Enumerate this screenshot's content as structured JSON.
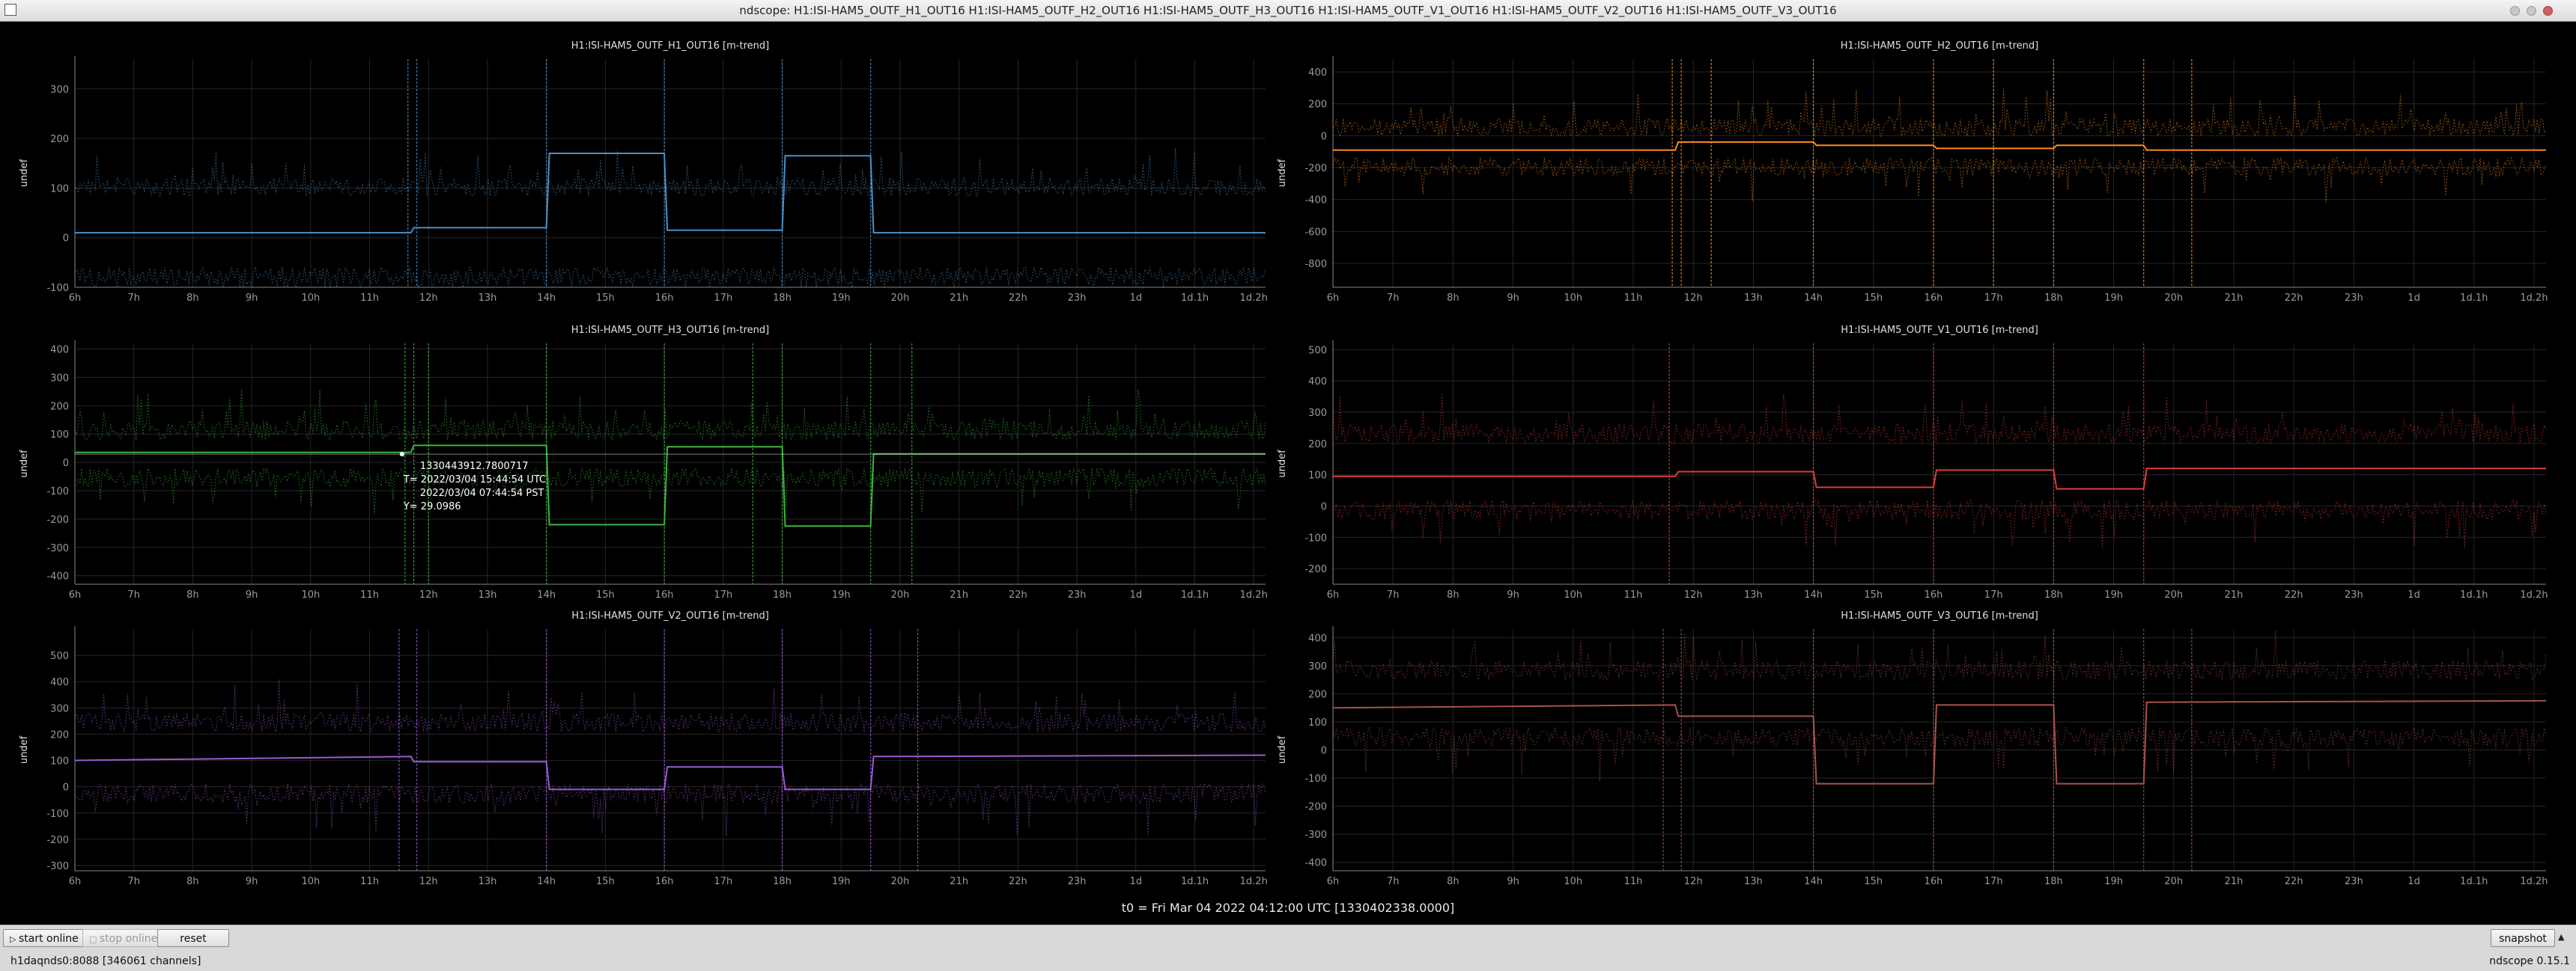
{
  "window": {
    "title": "ndscope: H1:ISI-HAM5_OUTF_H1_OUT16 H1:ISI-HAM5_OUTF_H2_OUT16 H1:ISI-HAM5_OUTF_H3_OUT16 H1:ISI-HAM5_OUTF_V1_OUT16 H1:ISI-HAM5_OUTF_V2_OUT16 H1:ISI-HAM5_OUTF_V3_OUT16"
  },
  "t0_label": "t0 = Fri Mar 04 2022 04:12:00 UTC [1330402338.0000]",
  "cursor_readout": {
    "gps": "1330443912.7800717",
    "t_utc": "T=  2022/03/04 15:44:54 UTC",
    "t_pst": "2022/03/04 07:44:54 PST",
    "y": "Y=  29.0986",
    "x_hours": 11.55,
    "y_value": 29.0986
  },
  "toolbar": {
    "start_online": "start online",
    "stop_online": "stop online",
    "reset": "reset",
    "snapshot": "snapshot",
    "snapshot_arrow": "▲"
  },
  "status": {
    "server": "h1daqnds0:8088 [346061 channels]",
    "version": "ndscope 0.15.1"
  },
  "chart_data": [
    {
      "type": "line",
      "title": "H1:ISI-HAM5_OUTF_H1_OUT16 [m-trend]",
      "ylabel": "undef",
      "color": "#4a90c8",
      "xlim": [
        6,
        26.2
      ],
      "ylim": [
        -100,
        360
      ],
      "yticks": [
        -100,
        0,
        100,
        200,
        300
      ],
      "x_ticks": [
        6,
        7,
        8,
        9,
        10,
        11,
        12,
        13,
        14,
        15,
        16,
        17,
        18,
        19,
        20,
        21,
        22,
        23,
        24,
        25,
        26
      ],
      "x_tick_labels": [
        "6h",
        "7h",
        "8h",
        "9h",
        "10h",
        "11h",
        "12h",
        "13h",
        "14h",
        "15h",
        "16h",
        "17h",
        "18h",
        "19h",
        "20h",
        "21h",
        "22h",
        "23h",
        "1d",
        "1d.1h",
        "1d.2h"
      ],
      "mean": [
        [
          6,
          10
        ],
        [
          11.7,
          10
        ],
        [
          11.75,
          20
        ],
        [
          14,
          20
        ],
        [
          14.05,
          170
        ],
        [
          16,
          170
        ],
        [
          16.05,
          15
        ],
        [
          18,
          15
        ],
        [
          18.05,
          165
        ],
        [
          19.5,
          165
        ],
        [
          19.55,
          10
        ],
        [
          26.2,
          10
        ]
      ],
      "max_band": 95,
      "min_band": -70,
      "spikes": [
        11.65,
        11.8,
        14,
        16,
        18,
        19.5
      ]
    },
    {
      "type": "line",
      "title": "H1:ISI-HAM5_OUTF_H2_OUT16 [m-trend]",
      "ylabel": "undef",
      "color": "#ff8c1a",
      "xlim": [
        6,
        26.2
      ],
      "ylim": [
        -950,
        480
      ],
      "yticks": [
        -800,
        -600,
        -400,
        -200,
        0,
        200,
        400
      ],
      "x_ticks": [
        6,
        7,
        8,
        9,
        10,
        11,
        12,
        13,
        14,
        15,
        16,
        17,
        18,
        19,
        20,
        21,
        22,
        23,
        24,
        25,
        26
      ],
      "x_tick_labels": [
        "6h",
        "7h",
        "8h",
        "9h",
        "10h",
        "11h",
        "12h",
        "13h",
        "14h",
        "15h",
        "16h",
        "17h",
        "18h",
        "19h",
        "20h",
        "21h",
        "22h",
        "23h",
        "1d",
        "1d.1h",
        "1d.2h"
      ],
      "mean": [
        [
          6,
          -90
        ],
        [
          11.7,
          -90
        ],
        [
          11.75,
          -40
        ],
        [
          14,
          -40
        ],
        [
          14.05,
          -60
        ],
        [
          16,
          -60
        ],
        [
          16.05,
          -80
        ],
        [
          18,
          -80
        ],
        [
          18.05,
          -60
        ],
        [
          19.5,
          -60
        ],
        [
          19.55,
          -90
        ],
        [
          26.2,
          -90
        ]
      ],
      "max_band": 30,
      "min_band": -170,
      "spikes": [
        11.65,
        11.8,
        12.3,
        14,
        16,
        17,
        18,
        19.5,
        20.3
      ]
    },
    {
      "type": "line",
      "title": "H1:ISI-HAM5_OUTF_H3_OUT16 [m-trend]",
      "ylabel": "undef",
      "color": "#3cb53c",
      "xlim": [
        6,
        26.2
      ],
      "ylim": [
        -430,
        420
      ],
      "yticks": [
        -400,
        -300,
        -200,
        -100,
        0,
        100,
        200,
        300,
        400
      ],
      "x_ticks": [
        6,
        7,
        8,
        9,
        10,
        11,
        12,
        13,
        14,
        15,
        16,
        17,
        18,
        19,
        20,
        21,
        22,
        23,
        24,
        25,
        26
      ],
      "x_tick_labels": [
        "6h",
        "7h",
        "8h",
        "9h",
        "10h",
        "11h",
        "12h",
        "13h",
        "14h",
        "15h",
        "16h",
        "17h",
        "18h",
        "19h",
        "20h",
        "21h",
        "22h",
        "23h",
        "1d",
        "1d.1h",
        "1d.2h"
      ],
      "mean": [
        [
          6,
          35
        ],
        [
          11.7,
          35
        ],
        [
          11.75,
          60
        ],
        [
          14,
          60
        ],
        [
          14.05,
          -220
        ],
        [
          16,
          -220
        ],
        [
          16.05,
          55
        ],
        [
          18,
          55
        ],
        [
          18.05,
          -225
        ],
        [
          19.5,
          -225
        ],
        [
          19.55,
          30
        ],
        [
          26.2,
          30
        ]
      ],
      "max_band": 100,
      "min_band": -40,
      "spikes": [
        11.6,
        11.75,
        12,
        14,
        16,
        17.5,
        18,
        19.5,
        20.2
      ]
    },
    {
      "type": "line",
      "title": "H1:ISI-HAM5_OUTF_V1_OUT16 [m-trend]",
      "ylabel": "undef",
      "color": "#e03b3b",
      "xlim": [
        6,
        26.2
      ],
      "ylim": [
        -250,
        520
      ],
      "yticks": [
        -200,
        -100,
        0,
        100,
        200,
        300,
        400,
        500
      ],
      "x_ticks": [
        6,
        7,
        8,
        9,
        10,
        11,
        12,
        13,
        14,
        15,
        16,
        17,
        18,
        19,
        20,
        21,
        22,
        23,
        24,
        25,
        26
      ],
      "x_tick_labels": [
        "6h",
        "7h",
        "8h",
        "9h",
        "10h",
        "11h",
        "12h",
        "13h",
        "14h",
        "15h",
        "16h",
        "17h",
        "18h",
        "19h",
        "20h",
        "21h",
        "22h",
        "23h",
        "1d",
        "1d.1h",
        "1d.2h"
      ],
      "mean": [
        [
          6,
          95
        ],
        [
          11.7,
          95
        ],
        [
          11.75,
          110
        ],
        [
          14,
          110
        ],
        [
          14.05,
          60
        ],
        [
          16,
          60
        ],
        [
          16.05,
          115
        ],
        [
          18,
          115
        ],
        [
          18.05,
          55
        ],
        [
          19.5,
          55
        ],
        [
          19.55,
          120
        ],
        [
          26.2,
          120
        ]
      ],
      "max_band": 220,
      "min_band": 0,
      "spikes": [
        11.6,
        14,
        16,
        18,
        19.5
      ]
    },
    {
      "type": "line",
      "title": "H1:ISI-HAM5_OUTF_V2_OUT16 [m-trend]",
      "ylabel": "undef",
      "color": "#9a5ad0",
      "xlim": [
        6,
        26.2
      ],
      "ylim": [
        -320,
        600
      ],
      "yticks": [
        -300,
        -200,
        -100,
        0,
        100,
        200,
        300,
        400,
        500
      ],
      "x_ticks": [
        6,
        7,
        8,
        9,
        10,
        11,
        12,
        13,
        14,
        15,
        16,
        17,
        18,
        19,
        20,
        21,
        22,
        23,
        24,
        25,
        26
      ],
      "x_tick_labels": [
        "6h",
        "7h",
        "8h",
        "9h",
        "10h",
        "11h",
        "12h",
        "13h",
        "14h",
        "15h",
        "16h",
        "17h",
        "18h",
        "19h",
        "20h",
        "21h",
        "22h",
        "23h",
        "1d",
        "1d.1h",
        "1d.2h"
      ],
      "mean": [
        [
          6,
          100
        ],
        [
          11.7,
          115
        ],
        [
          11.75,
          95
        ],
        [
          14,
          95
        ],
        [
          14.05,
          -10
        ],
        [
          16,
          -10
        ],
        [
          16.05,
          75
        ],
        [
          18,
          75
        ],
        [
          18.05,
          -10
        ],
        [
          19.5,
          -10
        ],
        [
          19.55,
          115
        ],
        [
          26.2,
          120
        ]
      ],
      "max_band": 230,
      "min_band": -10,
      "spikes": [
        11.5,
        11.8,
        14,
        16,
        18,
        19.5,
        20.3
      ]
    },
    {
      "type": "line",
      "title": "H1:ISI-HAM5_OUTF_V3_OUT16 [m-trend]",
      "ylabel": "undef",
      "color": "#a8524a",
      "xlim": [
        6,
        26.2
      ],
      "ylim": [
        -430,
        430
      ],
      "yticks": [
        -400,
        -300,
        -200,
        -100,
        0,
        100,
        200,
        300,
        400
      ],
      "x_ticks": [
        6,
        7,
        8,
        9,
        10,
        11,
        12,
        13,
        14,
        15,
        16,
        17,
        18,
        19,
        20,
        21,
        22,
        23,
        24,
        25,
        26
      ],
      "x_tick_labels": [
        "6h",
        "7h",
        "8h",
        "9h",
        "10h",
        "11h",
        "12h",
        "13h",
        "14h",
        "15h",
        "16h",
        "17h",
        "18h",
        "19h",
        "20h",
        "21h",
        "22h",
        "23h",
        "1d",
        "1d.1h",
        "1d.2h"
      ],
      "mean": [
        [
          6,
          150
        ],
        [
          11.7,
          160
        ],
        [
          11.75,
          120
        ],
        [
          14,
          120
        ],
        [
          14.05,
          -120
        ],
        [
          16,
          -120
        ],
        [
          16.05,
          160
        ],
        [
          18,
          160
        ],
        [
          18.05,
          -120
        ],
        [
          19.5,
          -120
        ],
        [
          19.55,
          170
        ],
        [
          26.2,
          175
        ]
      ],
      "max_band": 270,
      "min_band": 60,
      "spikes": [
        11.5,
        11.8,
        14,
        16,
        18,
        19.5,
        20.3
      ]
    }
  ]
}
